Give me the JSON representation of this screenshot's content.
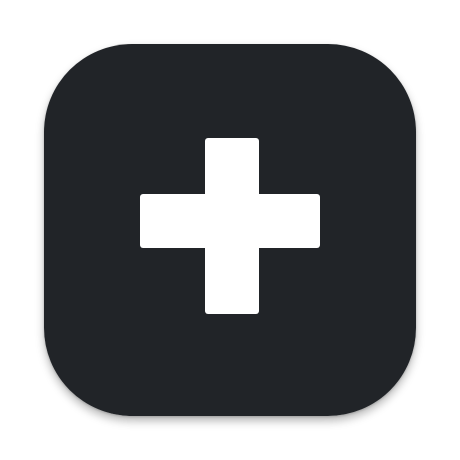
{
  "app_icon": {
    "icon": "plus-icon",
    "background_color": "#212428",
    "glyph_color": "#ffffff"
  },
  "page": {
    "background_color": "#ffffff"
  }
}
